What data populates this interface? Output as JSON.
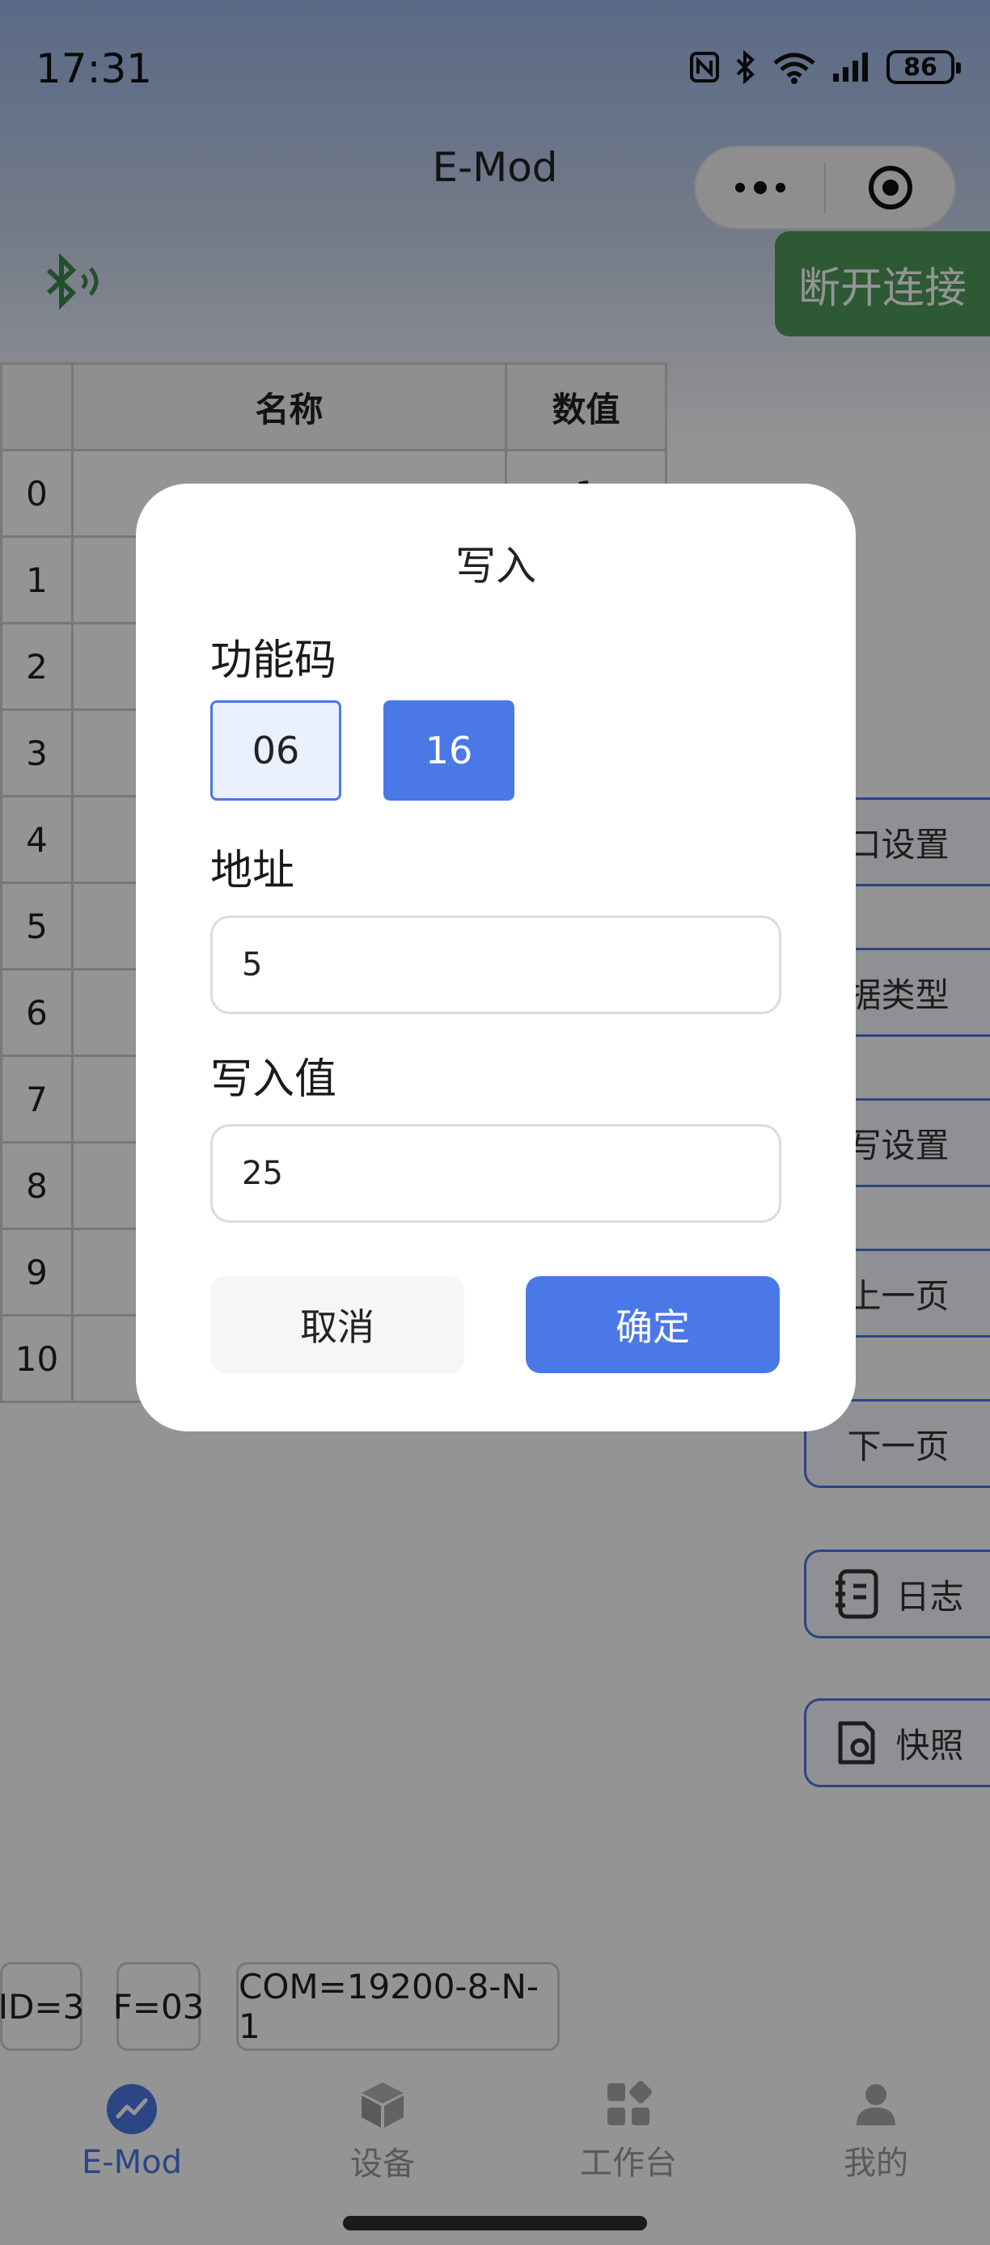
{
  "status_bar": {
    "time": "17:31",
    "battery": "86"
  },
  "nav": {
    "title": "E-Mod"
  },
  "toolbar": {
    "disconnect_label": "断开连接"
  },
  "table": {
    "headers": [
      "",
      "名称",
      "数值"
    ],
    "rows": [
      {
        "index": "0",
        "name": "",
        "value": "1"
      },
      {
        "index": "1",
        "name": "",
        "value": ""
      },
      {
        "index": "2",
        "name": "",
        "value": ""
      },
      {
        "index": "3",
        "name": "",
        "value": ""
      },
      {
        "index": "4",
        "name": "",
        "value": ""
      },
      {
        "index": "5",
        "name": "",
        "value": ""
      },
      {
        "index": "6",
        "name": "",
        "value": ""
      },
      {
        "index": "7",
        "name": "",
        "value": ""
      },
      {
        "index": "8",
        "name": "",
        "value": ""
      },
      {
        "index": "9",
        "name": "",
        "value": ""
      },
      {
        "index": "10",
        "name": "",
        "value": ""
      }
    ]
  },
  "side_menu": {
    "port_settings": "口设置",
    "data_type": "据类型",
    "rw_settings": "写设置",
    "prev_page": "上一页",
    "next_page": "下一页",
    "log": "日志",
    "snapshot": "快照"
  },
  "chips": {
    "id": "ID=3",
    "func": "F=03",
    "com": "COM=19200-8-N-1"
  },
  "tabbar": {
    "tabs": [
      {
        "label": "E-Mod",
        "icon": "chart-icon",
        "active": true
      },
      {
        "label": "设备",
        "icon": "cube-icon",
        "active": false
      },
      {
        "label": "工作台",
        "icon": "grid-icon",
        "active": false
      },
      {
        "label": "我的",
        "icon": "user-icon",
        "active": false
      }
    ]
  },
  "dialog": {
    "title": "写入",
    "function_code_label": "功能码",
    "function_codes": [
      "06",
      "16"
    ],
    "selected_function_code": "16",
    "address_label": "地址",
    "address_value": "5",
    "write_value_label": "写入值",
    "write_value": "25",
    "cancel_label": "取消",
    "confirm_label": "确定"
  },
  "colors": {
    "accent": "#4a78e6",
    "disconnect_green": "#4e9a5c"
  }
}
